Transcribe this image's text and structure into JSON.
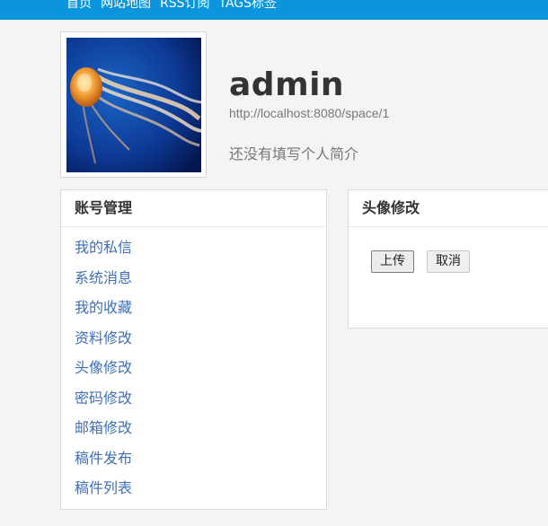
{
  "nav": {
    "items": [
      "首页",
      "网站地图",
      "RSS订阅",
      "TAGS标签"
    ]
  },
  "profile": {
    "username": "admin",
    "space_url": "http://localhost:8080/space/1",
    "bio": "还没有填写个人简介"
  },
  "account": {
    "title": "账号管理",
    "items": [
      "我的私信",
      "系统消息",
      "我的收藏",
      "资料修改",
      "头像修改",
      "密码修改",
      "邮箱修改",
      "稿件发布",
      "稿件列表"
    ]
  },
  "avatar_edit": {
    "title": "头像修改",
    "upload_label": "上传",
    "cancel_label": "取消"
  },
  "colors": {
    "topbar": "#0a95dc",
    "link": "#3f6fb4"
  }
}
